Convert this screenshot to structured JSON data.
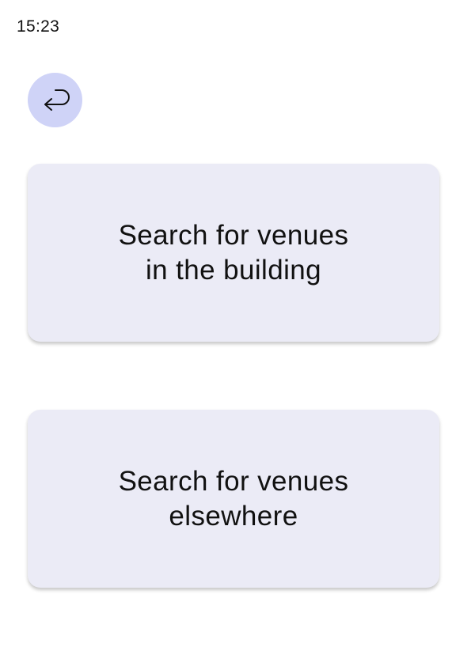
{
  "status_bar": {
    "time": "15:23"
  },
  "back_button": {
    "icon": "return-arrow-icon",
    "color": "#cfd3f7"
  },
  "options": [
    {
      "line1": "Search for venues",
      "line2": "in the building"
    },
    {
      "line1": "Search for venues",
      "line2": "elsewhere"
    }
  ],
  "colors": {
    "card_background": "#ebebf6",
    "text": "#111111"
  }
}
